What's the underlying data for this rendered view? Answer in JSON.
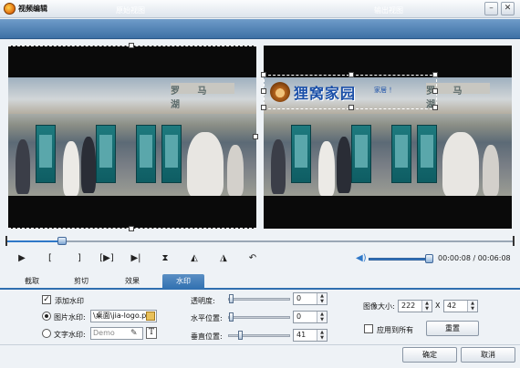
{
  "window": {
    "title": "视频编辑",
    "minimize": "–",
    "close": "✕"
  },
  "views": {
    "original": "原始视图",
    "output": "输出视图"
  },
  "scene": {
    "sign_text": "罗 马 湖"
  },
  "watermark": {
    "brand": "狸窝家园",
    "sub": "家居 ！"
  },
  "playback": {
    "position": "00:00:08",
    "duration": "00:06:08",
    "separator": " / ",
    "timeline_progress": 0.11,
    "volume": 0.88
  },
  "controls": [
    {
      "name": "play-button",
      "glyph": "▶"
    },
    {
      "name": "mark-in-button",
      "glyph": "["
    },
    {
      "name": "mark-out-button",
      "glyph": "]"
    },
    {
      "name": "play-segment-button",
      "glyph": "[▶]"
    },
    {
      "name": "next-frame-button",
      "glyph": "▶|"
    },
    {
      "name": "flip-vertical-button",
      "glyph": "⧗"
    },
    {
      "name": "rotate-left-button",
      "glyph": "◭"
    },
    {
      "name": "rotate-right-button",
      "glyph": "◮"
    },
    {
      "name": "undo-button",
      "glyph": "↶"
    }
  ],
  "tabs": [
    "截取",
    "剪切",
    "效果",
    "水印"
  ],
  "active_tab": 3,
  "watermark_panel": {
    "enable_label": "添加水印",
    "enable_checked": "✓",
    "image_label": "图片水印:",
    "image_path": "\\桌面\\jia-logo.p",
    "text_label": "文字水印:",
    "text_placeholder": "Demo",
    "text_icon": "T",
    "opacity_label": "透明度:",
    "opacity_value": "0",
    "hpos_label": "水平位置:",
    "hpos_value": "0",
    "vpos_label": "垂直位置:",
    "vpos_value": "41",
    "size_label": "图像大小:",
    "width_value": "222",
    "times": "X",
    "height_value": "42",
    "apply_all_label": "应用到所有",
    "reset_label": "重置"
  },
  "footer": {
    "ok": "确定",
    "cancel": "取消"
  },
  "colors": {
    "accent": "#2f6fb0",
    "header": "#3d70a5"
  }
}
